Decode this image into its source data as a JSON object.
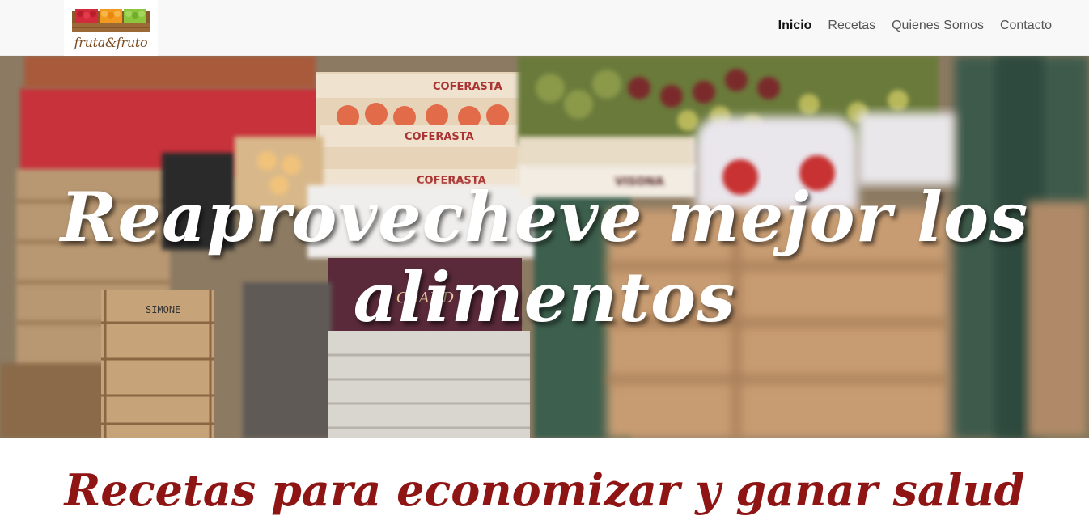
{
  "brand": {
    "logo_text": "fruta&fruto"
  },
  "nav": {
    "items": [
      {
        "label": "Inicio",
        "active": true
      },
      {
        "label": "Recetas",
        "active": false
      },
      {
        "label": "Quienes Somos",
        "active": false
      },
      {
        "label": "Contacto",
        "active": false
      }
    ]
  },
  "hero": {
    "title": "Reaprovecheve mejor los alimentos",
    "crate_labels": [
      "COFERASTA",
      "COFERASTA",
      "COFERASTA",
      "VISONA",
      "SIMONE",
      "GRAND"
    ]
  },
  "section": {
    "title": "Recetas para economizar y ganar salud"
  },
  "colors": {
    "accent_red": "#8f1414",
    "nav_bg": "#f8f8f8",
    "logo_brown": "#7a4a1e"
  }
}
